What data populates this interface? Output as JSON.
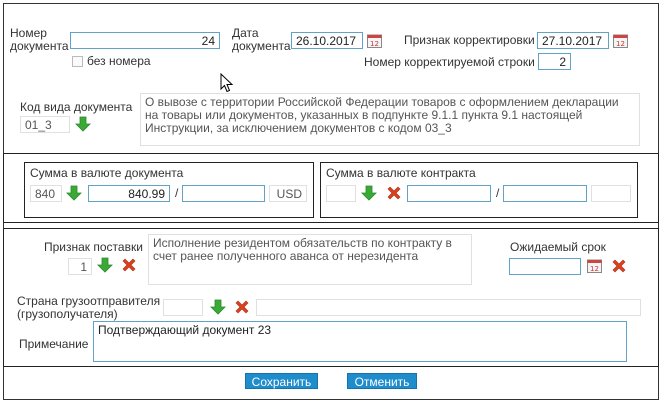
{
  "header": {
    "doc_number_label_1": "Номер",
    "doc_number_label_2": "документа",
    "doc_number_value": "24",
    "no_number_label": "без номера",
    "doc_date_label_1": "Дата",
    "doc_date_label_2": "документа",
    "doc_date_value": "26.10.2017",
    "correction_label": "Признак корректировки",
    "correction_date_value": "27.10.2017",
    "corrected_row_label": "Номер корректируемой строки",
    "corrected_row_value": "2",
    "calendar_day": "12",
    "doc_type_label": "Код вида документа",
    "doc_type_value": "01_3",
    "doc_type_description": "О вывозе с территории Российской Федерации товаров с оформлением декларации на товары или документов, указанных в подпункте 9.1.1 пункта 9.1 настоящей Инструкции, за исключением документов с кодом 03_3"
  },
  "amounts": {
    "doc_currency_label": "Сумма в валюте документа",
    "doc_currency_code": "840",
    "doc_amount_value": "840.99",
    "separator": "/",
    "doc_currency_name": "USD",
    "contract_currency_label": "Сумма в валюте контракта",
    "contract_separator": "/"
  },
  "delivery": {
    "delivery_sign_label": "Признак поставки",
    "delivery_sign_value": "1",
    "delivery_description": "Исполнение резидентом обязательств по контракту в счет ранее полученного аванса от нерезидента",
    "expected_term_label": "Ожидаемый срок",
    "shipper_label_1": "Страна грузоотправителя",
    "shipper_label_2": "(грузополучателя)",
    "note_label": "Примечание",
    "note_value": "Подтверждающий документ 23"
  },
  "footer": {
    "save_label": "Сохранить",
    "cancel_label": "Отменить"
  },
  "icons": {
    "calendar": "calendar-icon",
    "download": "green-arrow-down-icon",
    "clear": "red-x-icon",
    "cursor": "mouse-cursor-icon"
  },
  "colors": {
    "input_border": "#5fa3c7",
    "button_bg": "#1f8ccc",
    "arrow_green": "#3aa935",
    "clear_red": "#d9421c"
  }
}
